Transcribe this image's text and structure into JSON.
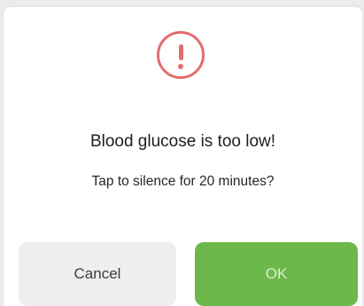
{
  "dialog": {
    "title": "Blood glucose is too low!",
    "message": "Tap to silence for 20 minutes?",
    "icon": "alert-circle-icon",
    "buttons": {
      "cancel_label": "Cancel",
      "ok_label": "OK"
    }
  },
  "colors": {
    "alert": "#e46d6d",
    "ok_button": "#6db84b",
    "cancel_button": "#eeeeef"
  }
}
